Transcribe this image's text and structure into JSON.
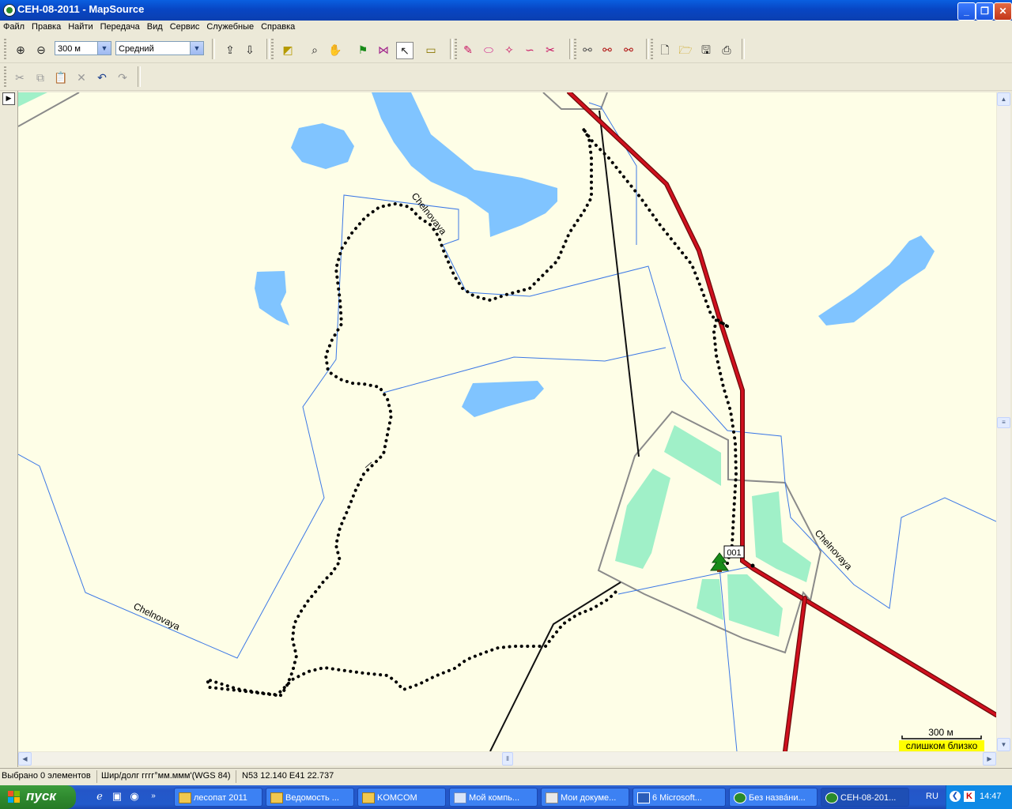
{
  "window": {
    "title": "СЕН-08-2011 - MapSource"
  },
  "menu": [
    "Файл",
    "Правка",
    "Найти",
    "Передача",
    "Вид",
    "Сервис",
    "Служебные",
    "Справка"
  ],
  "toolbar": {
    "zoom_value": "300 м",
    "detail_value": "Средний"
  },
  "map": {
    "road_labels": [
      "Chelnovaya",
      "Chelnovaya",
      "Chelnovaya"
    ],
    "waypoint_label": "001",
    "scale_label": "300 м",
    "scale_warning": "слишком близко",
    "colors": {
      "background": "#fefee7",
      "water": "#80c4ff",
      "forest": "#a0f0c8",
      "main_road": "#c8001e",
      "stream": "#3c78e6",
      "track": "#000000"
    }
  },
  "status": {
    "selection": "Выбрано 0 элементов",
    "format": "Шир/долг гггг°мм.ммм'(WGS 84)",
    "coords": "N53 12.140 E41 22.737"
  },
  "taskbar": {
    "start_label": "пуск",
    "tasks": [
      {
        "label": "лесопат 2011"
      },
      {
        "label": "Ведомость ..."
      },
      {
        "label": "KOMCOM"
      },
      {
        "label": "Мой компь..."
      },
      {
        "label": "Мои докуме..."
      },
      {
        "label": "6 Microsoft..."
      },
      {
        "label": "Без назвáни..."
      },
      {
        "label": "СЕН-08-201..."
      }
    ],
    "lang": "RU",
    "time": "14:47"
  }
}
